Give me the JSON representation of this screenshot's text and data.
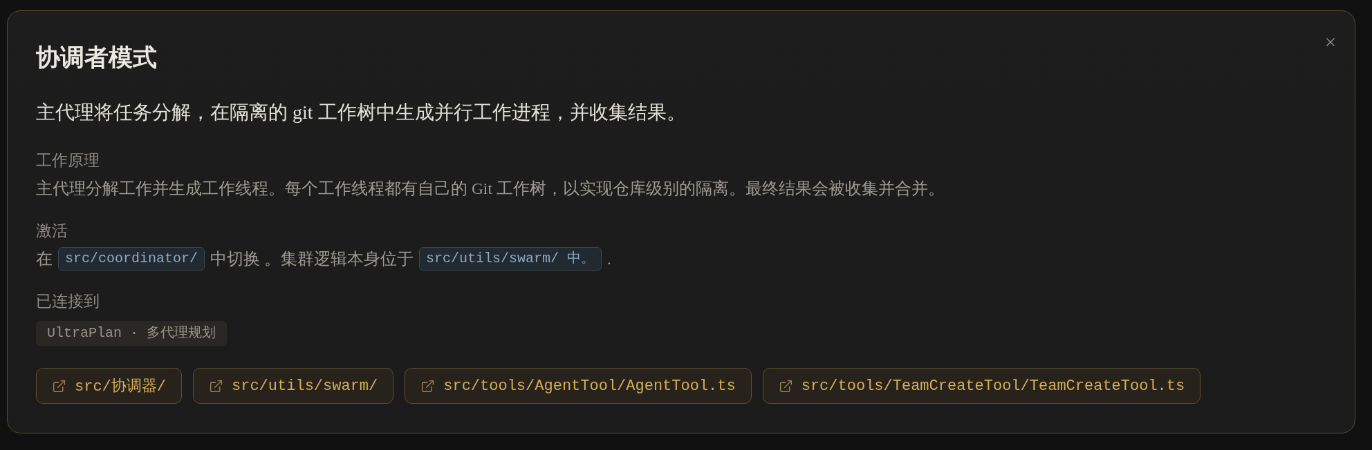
{
  "dialog": {
    "title": "协调者模式",
    "subtitle": "主代理将任务分解，在隔离的 git 工作树中生成并行工作进程，并收集结果。"
  },
  "sections": [
    {
      "heading": "工作原理",
      "parts": [
        {
          "kind": "text",
          "text": "主代理分解工作并生成工作线程。每个工作线程都有自己的 Git 工作树，以实现仓库级别的隔离。最终结果会被收集并合并。"
        }
      ]
    },
    {
      "heading": "激活",
      "parts": [
        {
          "kind": "text",
          "text": "在"
        },
        {
          "kind": "code",
          "text": "src/coordinator/"
        },
        {
          "kind": "text",
          "text": "中切换 。集群逻辑本身位于"
        },
        {
          "kind": "code",
          "text": "src/utils/swarm/ 中。"
        },
        {
          "kind": "text",
          "text": "."
        }
      ]
    },
    {
      "heading": "已连接到",
      "parts": [
        {
          "kind": "tag",
          "text": "UltraPlan · 多代理规划"
        }
      ]
    }
  ],
  "links": [
    {
      "label": "src/协调器/"
    },
    {
      "label": "src/utils/swarm/"
    },
    {
      "label": "src/tools/AgentTool/AgentTool.ts"
    },
    {
      "label": "src/tools/TeamCreateTool/TeamCreateTool.ts"
    }
  ]
}
